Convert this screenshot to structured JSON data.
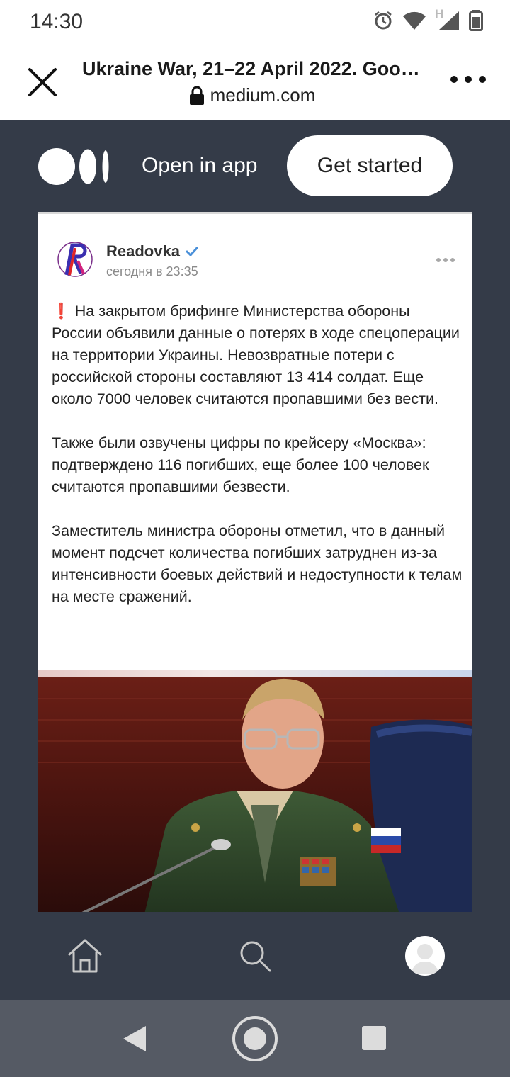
{
  "status_bar": {
    "time": "14:30",
    "network_letter": "H",
    "icons": [
      "alarm-icon",
      "wifi-icon",
      "signal-icon",
      "battery-icon"
    ]
  },
  "toolbar": {
    "page_title": "Ukraine War, 21–22 April 2022. Goo…",
    "domain": "medium.com",
    "icons": [
      "close-icon",
      "lock-icon",
      "more-vert-icon"
    ]
  },
  "medium_header": {
    "open_in_app": "Open in app",
    "get_started": "Get started"
  },
  "post": {
    "author": "Readovka",
    "timestamp": "сегодня в 23:35",
    "exclamation": "❗",
    "paragraphs": [
      "На закрытом брифинге Министерства обороны России объявили данные о потерях в ходе спецоперации на территории Украины. Невозвратные потери с российской стороны составляют 13 414 солдат. Еще около 7000 человек считаются пропавшими без вести.",
      "Также были озвучены цифры по крейсеру «Москва»: подтверждено 116 погибших, еще более 100 человек считаются пропавшими безвести.",
      "Заместитель министра обороны отметил, что в данный момент подсчет количества погибших затруднен из-за интенсивности боевых действий и недоступности к телам на месте сражений."
    ]
  },
  "bottom_nav": {
    "items": [
      "home-icon",
      "search-icon",
      "profile-avatar"
    ]
  },
  "colors": {
    "background": "#343b48",
    "verified": "#4a90d9",
    "accent_red": "#e0262a"
  }
}
